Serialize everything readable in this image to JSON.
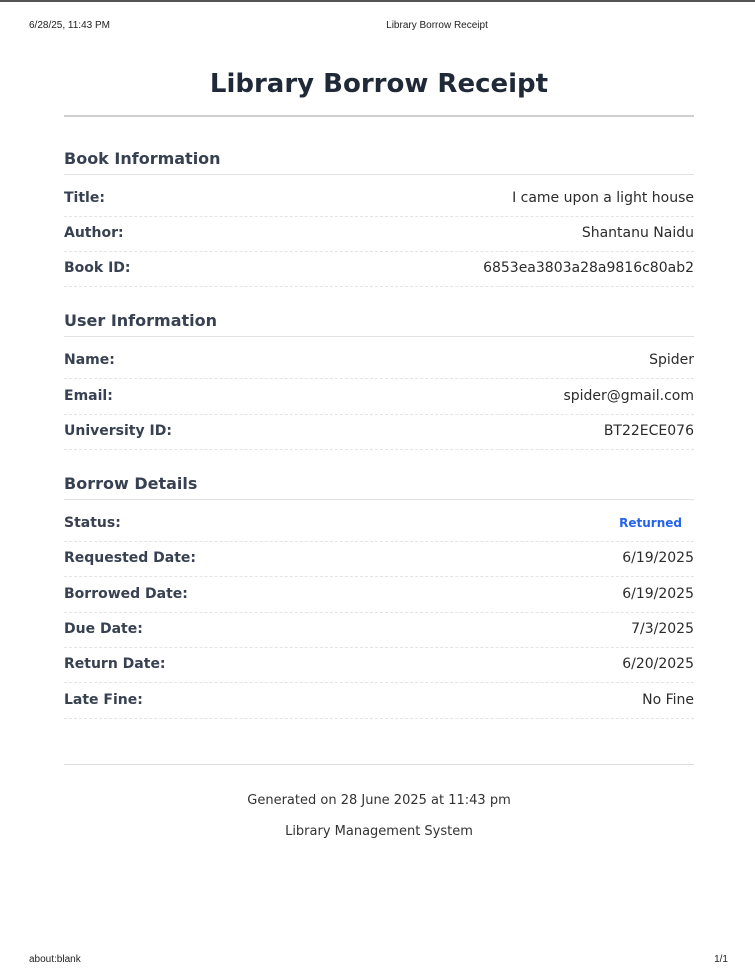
{
  "print_header": {
    "datetime": "6/28/25, 11:43 PM",
    "title": "Library Borrow Receipt"
  },
  "print_footer": {
    "url": "about:blank",
    "page": "1/1"
  },
  "receipt": {
    "title": "Library Borrow Receipt",
    "book_info": {
      "heading": "Book Information",
      "title_label": "Title:",
      "title_value": "I came upon a light house",
      "author_label": "Author:",
      "author_value": "Shantanu Naidu",
      "book_id_label": "Book ID:",
      "book_id_value": "6853ea3803a28a9816c80ab2"
    },
    "user_info": {
      "heading": "User Information",
      "name_label": "Name:",
      "name_value": "Spider",
      "email_label": "Email:",
      "email_value": "spider@gmail.com",
      "university_id_label": "University ID:",
      "university_id_value": "BT22ECE076"
    },
    "borrow_details": {
      "heading": "Borrow Details",
      "status_label": "Status:",
      "status_value": "Returned",
      "requested_label": "Requested Date:",
      "requested_value": "6/19/2025",
      "borrowed_label": "Borrowed Date:",
      "borrowed_value": "6/19/2025",
      "due_label": "Due Date:",
      "due_value": "7/3/2025",
      "return_label": "Return Date:",
      "return_value": "6/20/2025",
      "fine_label": "Late Fine:",
      "fine_value": "No Fine"
    },
    "footer": {
      "generated": "Generated on 28 June 2025 at 11:43 pm",
      "system": "Library Management System"
    }
  },
  "colors": {
    "status_accent": "#2563eb",
    "heading_text": "#374151",
    "title_text": "#1f2937"
  }
}
